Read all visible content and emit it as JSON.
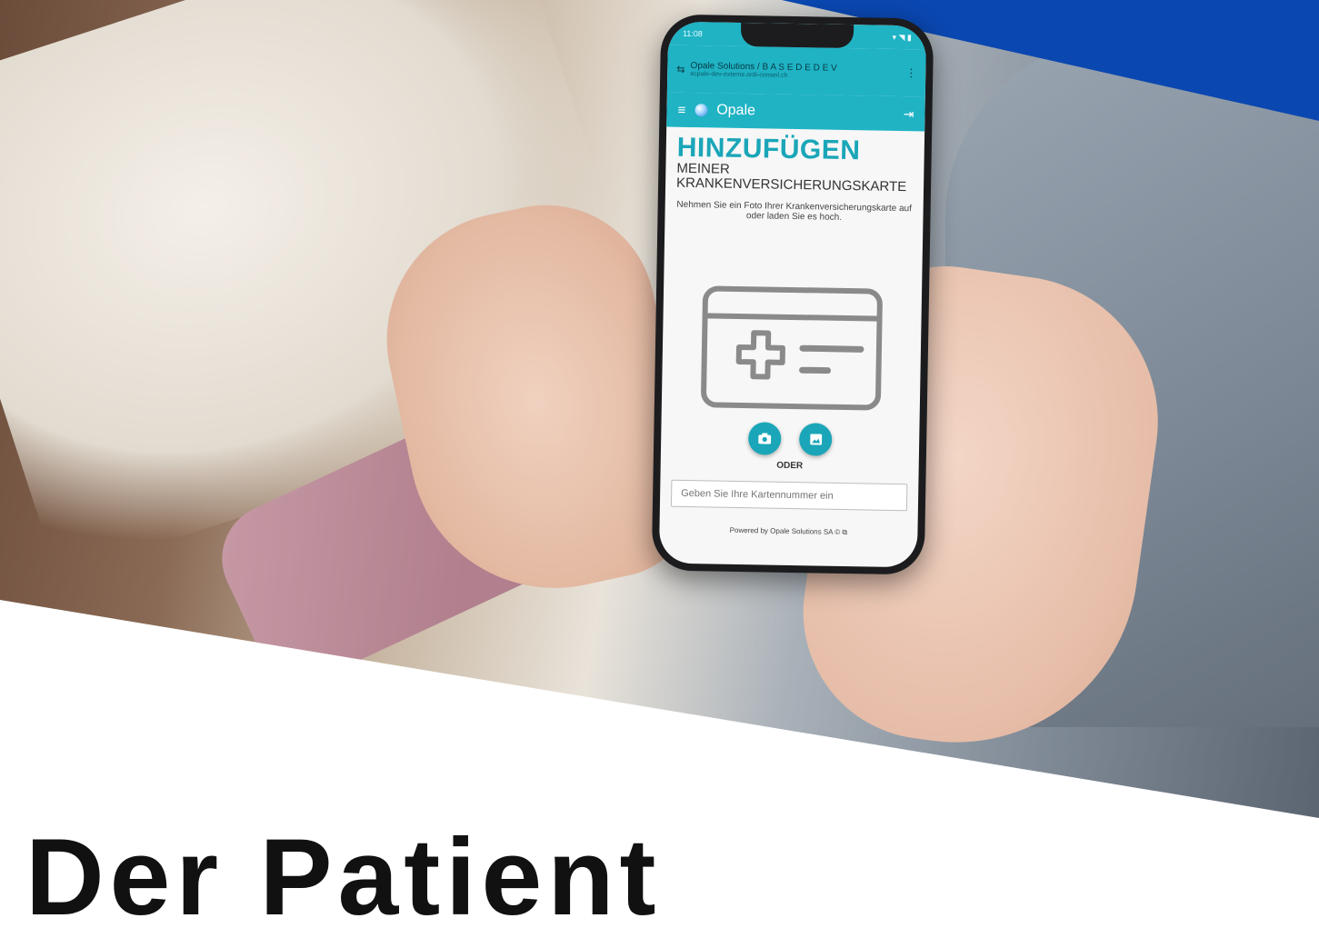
{
  "phone": {
    "status_time": "11:08",
    "status_icons": "▾ ◥ ▮",
    "browser": {
      "site_title": "Opale Solutions / B A S E D E D E V",
      "site_url": "ecpale-dev-externe.ordi-conseil.ch"
    },
    "app": {
      "title": "Opale"
    },
    "page": {
      "heading": "HINZUFÜGEN",
      "subheading_1": "MEINER",
      "subheading_2": "KRANKENVERSICHERUNGSKARTE",
      "description": "Nehmen Sie ein Foto Ihrer Krankenversicherungskarte auf oder laden Sie es hoch.",
      "or_label": "ODER",
      "card_input_placeholder": "Geben Sie Ihre Kartennummer ein",
      "footer": "Powered by Opale Solutions SA © ⧉"
    },
    "colors": {
      "accent": "#1aa6b8",
      "appbar": "#1fb3c4"
    }
  },
  "headline": "Der Patient"
}
